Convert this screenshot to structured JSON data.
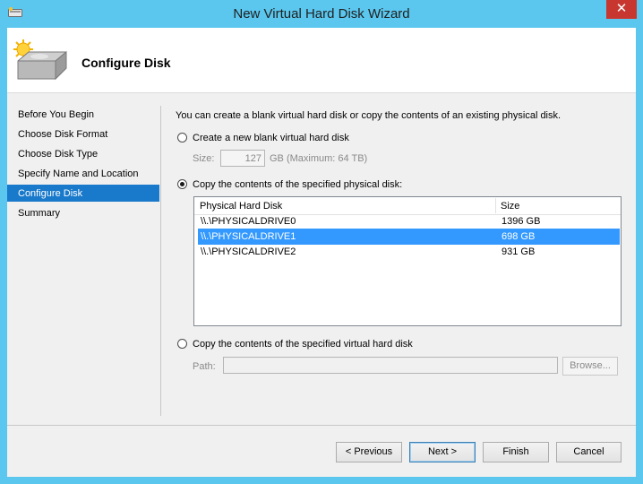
{
  "window": {
    "title": "New Virtual Hard Disk Wizard",
    "close_label": "✕"
  },
  "header": {
    "title": "Configure Disk",
    "icon": "disk-with-sun-icon"
  },
  "steps": [
    {
      "label": "Before You Begin"
    },
    {
      "label": "Choose Disk Format"
    },
    {
      "label": "Choose Disk Type"
    },
    {
      "label": "Specify Name and Location"
    },
    {
      "label": "Configure Disk",
      "selected": true
    },
    {
      "label": "Summary"
    }
  ],
  "content": {
    "intro": "You can create a blank virtual hard disk or copy the contents of an existing physical disk.",
    "option_blank": {
      "label": "Create a new blank virtual hard disk",
      "checked": false
    },
    "size": {
      "label": "Size:",
      "value": "127",
      "suffix": "GB (Maximum: 64 TB)"
    },
    "option_physical": {
      "label": "Copy the contents of the specified physical disk:",
      "checked": true
    },
    "disk_table": {
      "columns": [
        "Physical Hard Disk",
        "Size"
      ],
      "rows": [
        {
          "disk": "\\\\.\\PHYSICALDRIVE0",
          "size": "1396 GB",
          "selected": false
        },
        {
          "disk": "\\\\.\\PHYSICALDRIVE1",
          "size": "698 GB",
          "selected": true
        },
        {
          "disk": "\\\\.\\PHYSICALDRIVE2",
          "size": "931 GB",
          "selected": false
        }
      ]
    },
    "option_virtual": {
      "label": "Copy the contents of the specified virtual hard disk",
      "checked": false
    },
    "path": {
      "label": "Path:",
      "value": "",
      "browse_label": "Browse..."
    }
  },
  "buttons": {
    "previous": "< Previous",
    "next": "Next >",
    "finish": "Finish",
    "cancel": "Cancel"
  },
  "colors": {
    "titlebar": "#5bc7ee",
    "selection": "#1979ca",
    "row_selection": "#3399ff",
    "close": "#c7372f"
  }
}
